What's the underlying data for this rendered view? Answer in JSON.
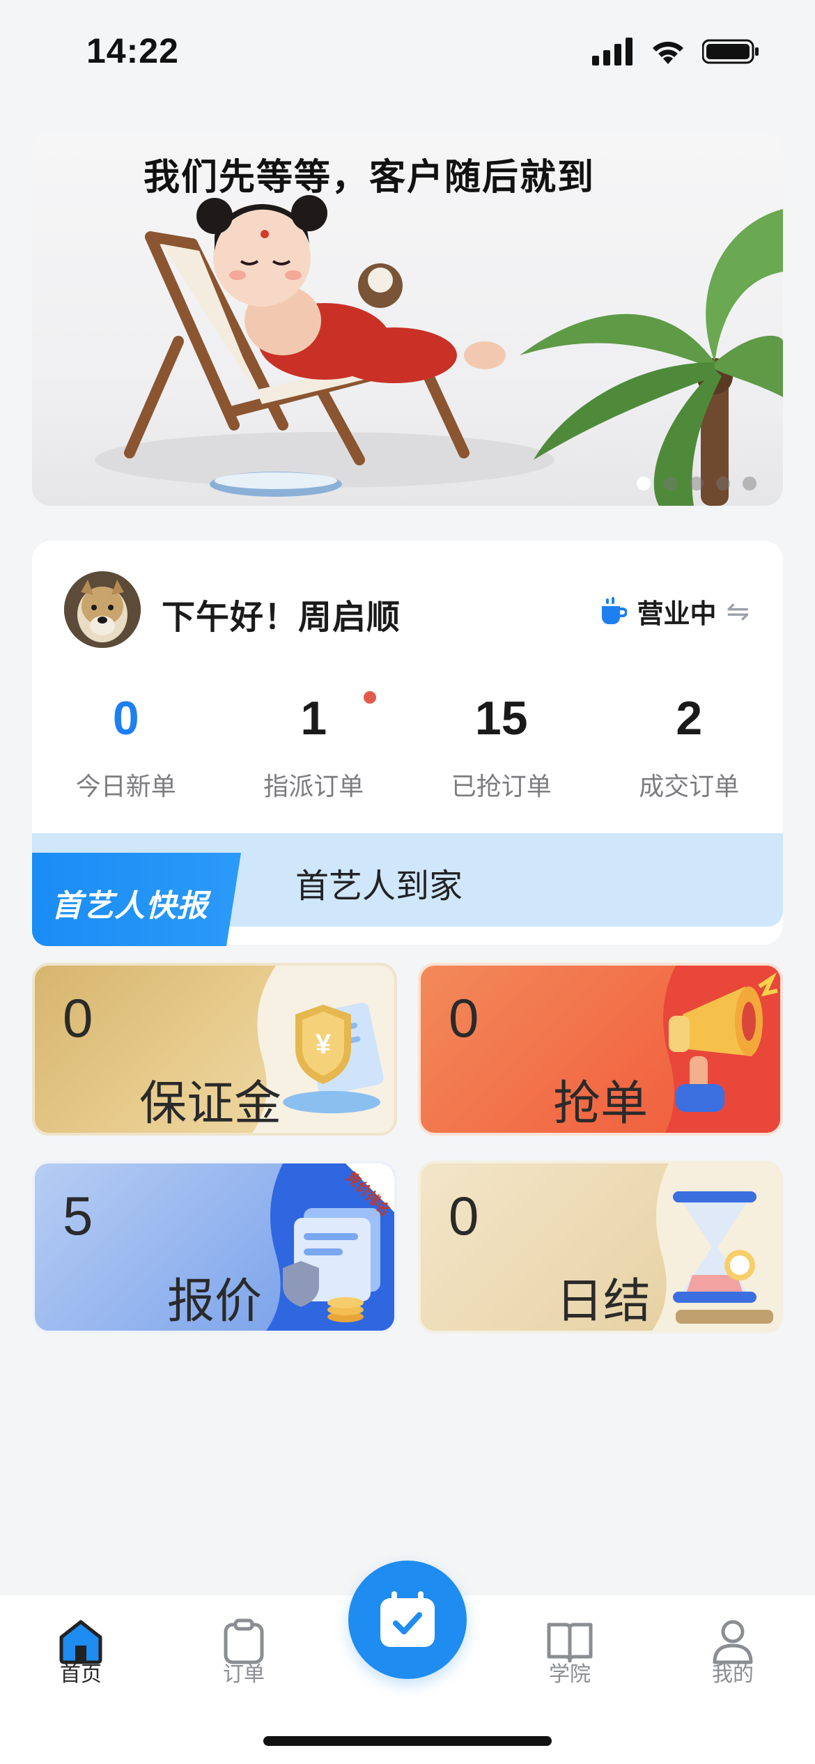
{
  "status_bar": {
    "time": "14:22"
  },
  "banner": {
    "title": "我们先等等，客户随后就到",
    "dot_count": 5,
    "active_dot": 0
  },
  "profile": {
    "greeting": "下午好！周启顺",
    "business_status": "营业中"
  },
  "stats": [
    {
      "value": "0",
      "label": "今日新单"
    },
    {
      "value": "1",
      "label": "指派订单"
    },
    {
      "value": "15",
      "label": "已抢订单"
    },
    {
      "value": "2",
      "label": "成交订单"
    }
  ],
  "news": {
    "badge": "首艺人快报",
    "text": "首艺人到家"
  },
  "cards": {
    "deposit": {
      "value": "0",
      "label": "保证金"
    },
    "grab": {
      "value": "0",
      "label": "抢单"
    },
    "quote": {
      "value": "5",
      "label": "报价",
      "ribbon": "竞价排名"
    },
    "daily": {
      "value": "0",
      "label": "日结"
    }
  },
  "tabbar": {
    "home": "首页",
    "orders": "订单",
    "academy": "学院",
    "mine": "我的"
  },
  "colors": {
    "accent": "#1e8cf0",
    "stat_highlight": "#1e7ff0",
    "dot_red": "#e35b4c"
  }
}
